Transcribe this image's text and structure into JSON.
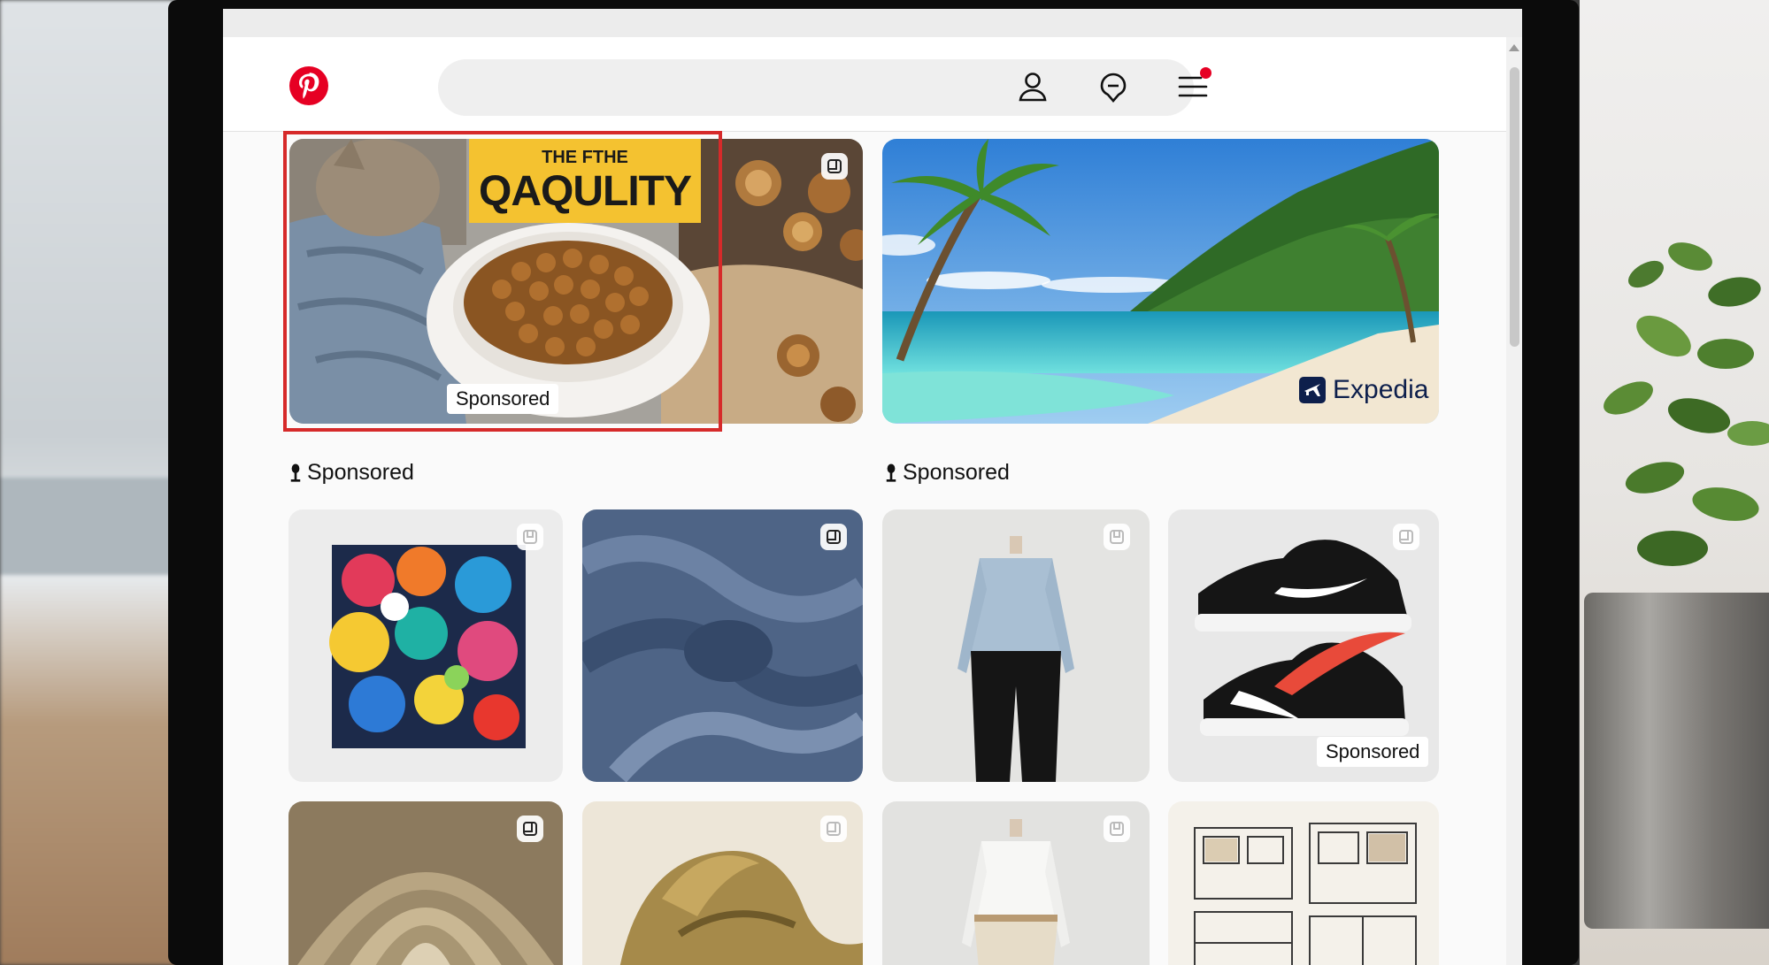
{
  "header": {
    "logo_name": "Pinterest",
    "search_placeholder": "",
    "icons": [
      "profile-icon",
      "message-icon",
      "menu-icon"
    ],
    "has_notification": true
  },
  "feed": {
    "top_row": [
      {
        "name": "cat-food-pin",
        "overlay_line1": "THE FTHE",
        "overlay_line2": "QAQULITY",
        "badge": "Sponsored",
        "highlighted": true
      },
      {
        "name": "beach-pin",
        "brand": "Expedia"
      }
    ],
    "section_labels": [
      "Sponsored",
      "Sponsored"
    ],
    "grid_row_1": [
      {
        "name": "abstract-painting-pin"
      },
      {
        "name": "denim-fabric-pin"
      },
      {
        "name": "blouse-pin"
      },
      {
        "name": "sneakers-pin",
        "badge": "Sponsored"
      }
    ],
    "grid_row_2": [
      {
        "name": "cathedral-ceiling-pin"
      },
      {
        "name": "gold-sculpture-pin"
      },
      {
        "name": "white-shirt-pin"
      },
      {
        "name": "architecture-sketch-pin"
      }
    ]
  },
  "colors": {
    "brand_red": "#e60023",
    "highlight_red": "#d62a2a",
    "overlay_yellow": "#f4c230",
    "expedia_navy": "#0d1f4c"
  }
}
